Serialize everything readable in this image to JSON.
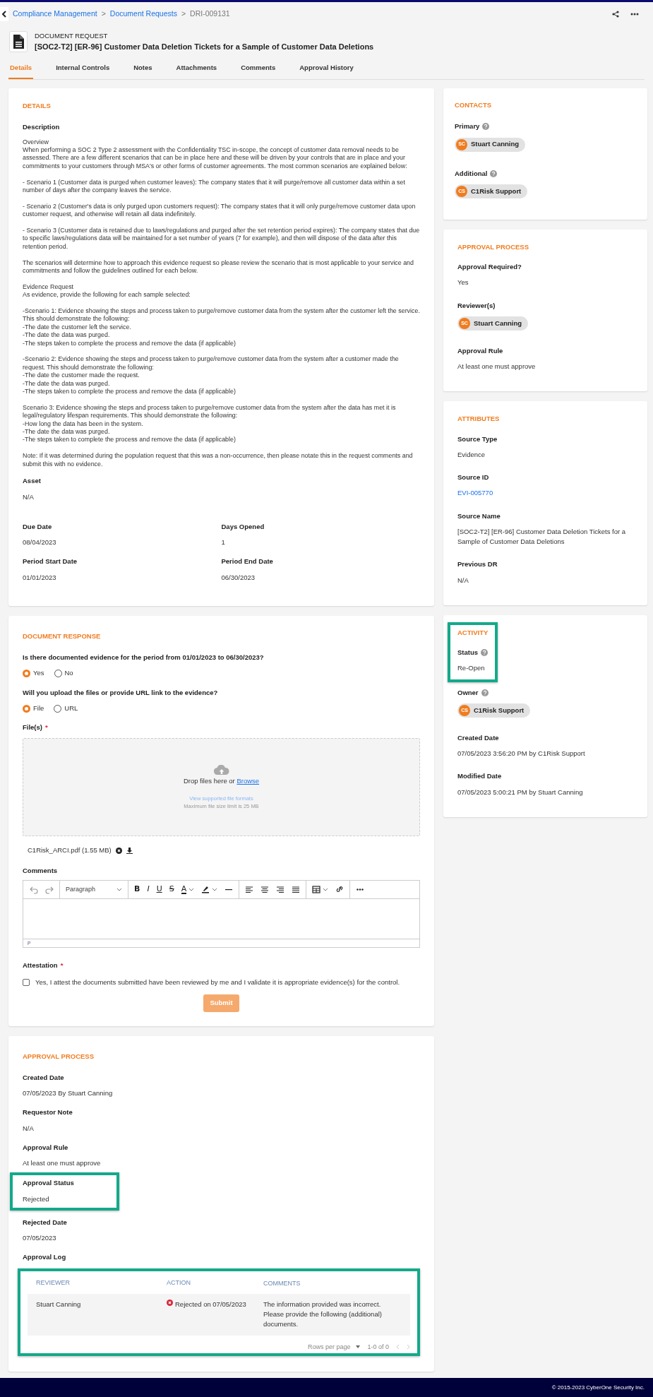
{
  "breadcrumb": [
    {
      "kind": "link",
      "label": "Compliance Management"
    },
    {
      "kind": "sep",
      "label": ">"
    },
    {
      "kind": "link",
      "label": "Document Requests"
    },
    {
      "kind": "sep",
      "label": ">"
    },
    {
      "kind": "current",
      "label": "DRI-009131"
    }
  ],
  "header": {
    "type_label": "DOCUMENT REQUEST",
    "title": "[SOC2-T2] [ER-96] Customer Data Deletion Tickets for a Sample of Customer Data Deletions"
  },
  "tabs": [
    {
      "label": "Details",
      "selected": true
    },
    {
      "label": "Internal Controls",
      "selected": false
    },
    {
      "label": "Notes",
      "selected": false
    },
    {
      "label": "Attachments",
      "selected": false
    },
    {
      "label": "Comments",
      "selected": false
    },
    {
      "label": "Approval History",
      "selected": false
    }
  ],
  "details": {
    "heading": "DETAILS",
    "description_label": "Description",
    "description": [
      "Overview\nWhen performing a SOC 2 Type 2 assessment with the Confidentiality TSC in-scope, the concept of customer data removal needs to be assessed. There are a few different scenarios that can be in place here and these will be driven by your controls that are in place and your commitments to your customers through MSA's or other forms of customer agreements. The most common scenarios are explained below:",
      "- Scenario 1 (Customer data is purged when customer leaves): The company states that it will purge/remove all customer data within a set number of days after the company leaves the service.",
      "- Scenario 2 (Customer's data is only purged upon customers request): The company states that it will only purge/remove customer data upon customer request, and otherwise will retain all data indefinitely.",
      "- Scenario 3 (Customer data is retained due to laws/regulations and purged after the set retention period expires): The company states that due to specific laws/regulations data will be maintained for a set number of years (7 for example), and then will dispose of the data after this retention period.",
      "The scenarios will determine how to approach this evidence request so please review the scenario that is most applicable to your service and commitments and follow the guidelines outlined for each below.",
      "Evidence Request\nAs evidence, provide the following for each sample selected:",
      "-Scenario 1: Evidence showing the steps and process taken to purge/remove customer data from the system after the customer left the service. This should demonstrate the following:\n-The date the customer left the service.\n-The date the data was purged.\n-The steps taken to complete the process and remove the data (if applicable)",
      "-Scenario 2: Evidence showing the steps and process taken to purge/remove customer data from the system after a customer made the request. This should demonstrate the following:\n-The date the customer made the request.\n-The date the data was purged.\n-The steps taken to complete the process and remove the data (if applicable)",
      "Scenario 3: Evidence showing the steps and process taken to purge/remove customer data from the system after the data has met it is legal/regulatory lifespan requirements. This should demonstrate the following:\n-How long the data has been in the system.\n-The date the data was purged.\n-The steps taken to complete the process and remove the data (if applicable)",
      "Note: If it was determined during the population request that this was a non-occurrence, then please notate this in the request comments and submit this with no evidence."
    ],
    "fields": [
      {
        "kind": "wide",
        "label": "Asset",
        "value": "N/A"
      },
      {
        "kind": "half",
        "label": "Due Date",
        "value": "08/04/2023"
      },
      {
        "kind": "half",
        "label": "Days Opened",
        "value": "1"
      },
      {
        "kind": "half",
        "label": "Period Start Date",
        "value": "01/01/2023"
      },
      {
        "kind": "half",
        "label": "Period End Date",
        "value": "06/30/2023"
      }
    ]
  },
  "response": {
    "heading": "DOCUMENT RESPONSE",
    "questions": [
      {
        "label": "Is there documented evidence for the period from 01/01/2023 to 06/30/2023?",
        "options": [
          {
            "label": "Yes",
            "selected": true
          },
          {
            "label": "No",
            "selected": false
          }
        ]
      },
      {
        "label": "Will you upload the files or provide URL link to the evidence?",
        "options": [
          {
            "label": "File",
            "selected": true
          },
          {
            "label": "URL",
            "selected": false
          }
        ]
      }
    ],
    "files_label": "File(s)",
    "files_required_mark": "*",
    "dropzone": {
      "prompt": "Drop files here or",
      "link": "Browse",
      "formats_link": "View supported file formats",
      "limit": "Maximum file size limit is 25 MB"
    },
    "files": [
      {
        "name": "C1Risk_ARCI.pdf (1.55 MB)"
      }
    ],
    "comments_label": "Comments",
    "toolbar": [
      {
        "kind": "undo"
      },
      {
        "kind": "redo"
      },
      {
        "kind": "divider"
      },
      {
        "kind": "block-format",
        "label": "Paragraph"
      },
      {
        "kind": "divider"
      },
      {
        "kind": "bold",
        "glyph": "B"
      },
      {
        "kind": "italic",
        "glyph": "I"
      },
      {
        "kind": "underline",
        "glyph": "U"
      },
      {
        "kind": "strikethrough",
        "glyph": "S"
      },
      {
        "kind": "text-color",
        "glyph": "A"
      },
      {
        "kind": "highlight"
      },
      {
        "kind": "horizontal-line"
      },
      {
        "kind": "divider"
      },
      {
        "kind": "align-left"
      },
      {
        "kind": "align-center"
      },
      {
        "kind": "align-right"
      },
      {
        "kind": "justify"
      },
      {
        "kind": "divider"
      },
      {
        "kind": "table"
      },
      {
        "kind": "link"
      },
      {
        "kind": "divider"
      },
      {
        "kind": "more"
      }
    ],
    "editor_path": "P",
    "attestation": {
      "label": "Attestation",
      "required_mark": "*",
      "text": "Yes, I attest the documents submitted have been reviewed by me and I validate it is appropriate evidence(s) for the control.",
      "checked": false
    },
    "submit": {
      "label": "Submit",
      "disabled": true
    }
  },
  "approval": {
    "heading": "APPROVAL PROCESS",
    "fields": [
      {
        "label": "Created Date",
        "value": "07/05/2023 By Stuart Canning"
      },
      {
        "label": "Requestor Note",
        "value": "N/A"
      },
      {
        "label": "Approval Rule",
        "value": "At least one must approve"
      },
      {
        "label": "Approval Status",
        "value": "Rejected",
        "highlighted": true
      },
      {
        "label": "Rejected Date",
        "value": "07/05/2023"
      }
    ],
    "log_label": "Approval Log",
    "log": {
      "highlighted": true,
      "columns": [
        "REVIEWER",
        "ACTION",
        "COMMENTS"
      ],
      "rows": [
        {
          "reviewer": "Stuart Canning",
          "action": "Rejected on 07/05/2023",
          "kind": "rejected",
          "comments": "The information provided was incorrect. Please provide the following (additional) documents."
        }
      ],
      "rows_per_page": "Rows per page",
      "range": "1-0 of 0"
    }
  },
  "contacts": {
    "heading": "CONTACTS",
    "groups": [
      {
        "label": "Primary",
        "help": true,
        "people": [
          {
            "initials": "SC",
            "name": "Stuart Canning"
          }
        ]
      },
      {
        "label": "Additional",
        "help": true,
        "people": [
          {
            "initials": "CS",
            "name": "C1Risk Support"
          }
        ]
      }
    ]
  },
  "sidebar_cards": [
    {
      "heading": "APPROVAL PROCESS",
      "fields": [
        {
          "kind": "text",
          "label": "Approval Required?",
          "value": "Yes"
        },
        {
          "kind": "people",
          "label": "Reviewer(s)",
          "people": [
            {
              "initials": "SC",
              "name": "Stuart Canning"
            }
          ]
        },
        {
          "kind": "text",
          "label": "Approval Rule",
          "value": "At least one must approve"
        }
      ]
    },
    {
      "heading": "ATTRIBUTES",
      "fields": [
        {
          "kind": "text",
          "label": "Source Type",
          "value": "Evidence"
        },
        {
          "kind": "link",
          "label": "Source ID",
          "value": "EVI-005770"
        },
        {
          "kind": "text",
          "label": "Source Name",
          "value": "[SOC2-T2] [ER-96] Customer Data Deletion Tickets for a Sample of Customer Data Deletions"
        },
        {
          "kind": "text",
          "label": "Previous DR",
          "value": "N/A"
        }
      ]
    },
    {
      "heading": "ACTIVITY",
      "highlighted": true,
      "fields": [
        {
          "kind": "text",
          "label": "Status",
          "value": "Re-Open",
          "help": true,
          "highlighted": true
        },
        {
          "kind": "people",
          "label": "Owner",
          "people": [
            {
              "initials": "CS",
              "name": "C1Risk Support"
            }
          ],
          "help": true
        },
        {
          "kind": "text",
          "label": "Created Date",
          "value": "07/05/2023 3:56:20 PM by C1Risk Support"
        },
        {
          "kind": "text",
          "label": "Modified Date",
          "value": "07/05/2023 5:00:21 PM by Stuart Canning"
        }
      ]
    }
  ],
  "footer": "© 2015-2023 CyberOne Security Inc."
}
